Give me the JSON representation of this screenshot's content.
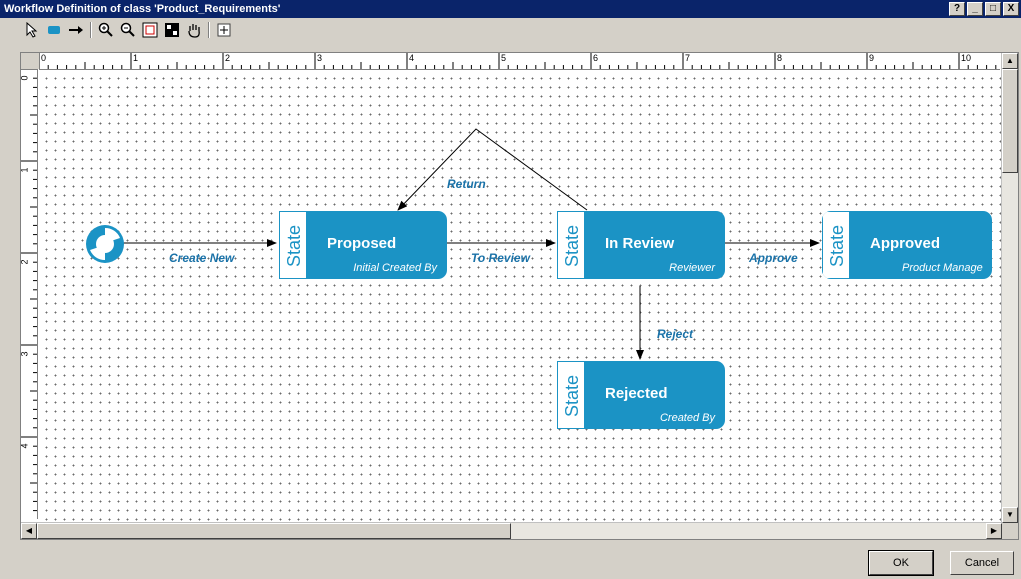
{
  "window": {
    "title": "Workflow Definition of class 'Product_Requirements'",
    "controls": [
      "?",
      "_",
      "□",
      "X"
    ]
  },
  "toolbar": {
    "tools": [
      {
        "name": "select-tool",
        "icon": "pointer-icon"
      },
      {
        "name": "state-tool",
        "icon": "state-rect-icon"
      },
      {
        "name": "transition-tool",
        "icon": "arrow-right-icon"
      },
      {
        "name": "zoom-in-tool",
        "icon": "zoom-in-icon"
      },
      {
        "name": "zoom-out-tool",
        "icon": "zoom-out-icon"
      },
      {
        "name": "fit-width-tool",
        "icon": "fit-width-icon"
      },
      {
        "name": "fit-all-tool",
        "icon": "fit-all-icon"
      },
      {
        "name": "pan-tool",
        "icon": "hand-icon"
      },
      {
        "name": "grid-tool",
        "icon": "grid-icon"
      }
    ]
  },
  "rulers": {
    "horizontal": [
      "0",
      "1",
      "2",
      "3",
      "4",
      "5",
      "6",
      "7",
      "8",
      "9",
      "10"
    ],
    "vertical": [
      "0",
      "1",
      "2",
      "3",
      "4"
    ]
  },
  "diagram": {
    "start_icon": "start-node-icon",
    "state_tag": "State",
    "states": [
      {
        "id": "proposed",
        "name": "Proposed",
        "actor": "Initial Created By"
      },
      {
        "id": "in_review",
        "name": "In Review",
        "actor": "Reviewer"
      },
      {
        "id": "approved",
        "name": "Approved",
        "actor": "Product Manage"
      },
      {
        "id": "rejected",
        "name": "Rejected",
        "actor": "Created By"
      }
    ],
    "transitions": [
      {
        "label": "Create New"
      },
      {
        "label": "To Review"
      },
      {
        "label": "Approve"
      },
      {
        "label": "Reject"
      },
      {
        "label": "Return"
      }
    ],
    "colors": {
      "state_fill": "#1b93c5",
      "label": "#1a72a8",
      "line": "#000000"
    }
  },
  "buttons": {
    "ok": "OK",
    "cancel": "Cancel"
  }
}
